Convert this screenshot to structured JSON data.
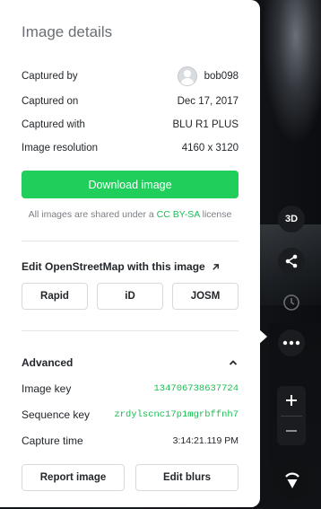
{
  "panel": {
    "title": "Image details",
    "details": [
      {
        "label": "Captured by",
        "value": "bob098"
      },
      {
        "label": "Captured on",
        "value": "Dec 17, 2017"
      },
      {
        "label": "Captured with",
        "value": "BLU R1 PLUS"
      },
      {
        "label": "Image resolution",
        "value": "4160 x 3120"
      }
    ],
    "download_label": "Download image",
    "license": {
      "prefix": "All images are shared under a ",
      "link": "CC BY-SA",
      "suffix": " license"
    },
    "osm": {
      "heading": "Edit OpenStreetMap with this image",
      "editors": [
        "Rapid",
        "iD",
        "JOSM"
      ]
    },
    "advanced": {
      "heading": "Advanced",
      "rows": [
        {
          "label": "Image key",
          "value": "134706738637724"
        },
        {
          "label": "Sequence key",
          "value": "zrdylscnc17p1mgrbffnh7"
        },
        {
          "label": "Capture time",
          "value": "3:14:21.119 PM"
        }
      ]
    },
    "actions": {
      "report": "Report image",
      "blurs": "Edit blurs"
    }
  },
  "controls": {
    "threed_label": "3D",
    "icons": [
      "share-icon",
      "history-icon",
      "more-icon",
      "plus-icon",
      "minus-icon",
      "compass-icon"
    ]
  },
  "colors": {
    "accent_green": "#1fce5b",
    "link_green": "#1dbd55",
    "panel_bg": "#ffffff",
    "control_bg": "#1a1c20"
  }
}
